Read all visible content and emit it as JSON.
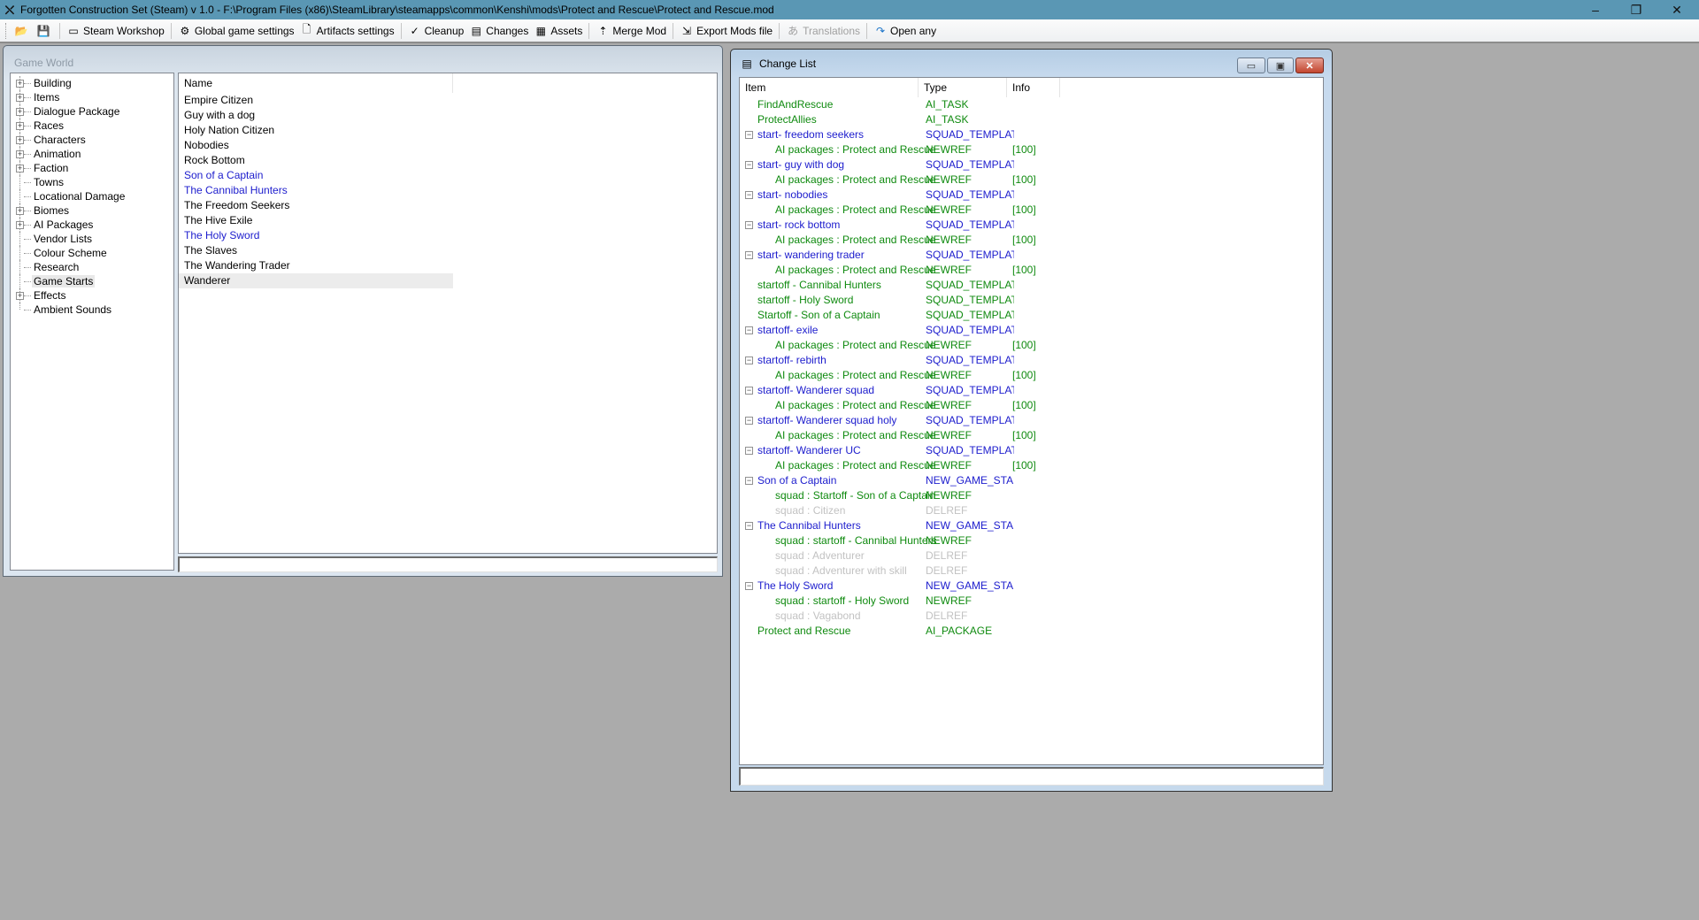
{
  "window": {
    "title": "Forgotten Construction Set (Steam) v 1.0 - F:\\Program Files (x86)\\SteamLibrary\\steamapps\\common\\Kenshi\\mods\\Protect and Rescue\\Protect and Rescue.mod",
    "controls": {
      "minimize": "–",
      "restore": "❐",
      "close": "✕"
    }
  },
  "toolbar": {
    "items": [
      {
        "label": "",
        "icon": "open-icon",
        "glyph": "📂"
      },
      {
        "label": "",
        "icon": "save-icon",
        "glyph": "💾"
      },
      {
        "label": "Steam Workshop",
        "icon": "workshop-icon",
        "glyph": "▭"
      },
      {
        "label": "Global game settings",
        "icon": "gear-icon",
        "glyph": "⚙"
      },
      {
        "label": "Artifacts settings",
        "icon": "document-gear-icon",
        "glyph": "🗋"
      },
      {
        "label": "Cleanup",
        "icon": "broom-icon",
        "glyph": "✓"
      },
      {
        "label": "Changes",
        "icon": "changes-icon",
        "glyph": "▤"
      },
      {
        "label": "Assets",
        "icon": "assets-icon",
        "glyph": "▦"
      },
      {
        "label": "Merge Mod",
        "icon": "merge-icon",
        "glyph": "⇡"
      },
      {
        "label": "Export Mods file",
        "icon": "export-icon",
        "glyph": "⇲"
      },
      {
        "label": "Translations",
        "icon": "translate-icon",
        "glyph": "あ",
        "disabled": true
      },
      {
        "label": "Open any",
        "icon": "redo-arrow-icon",
        "glyph": "↷"
      }
    ]
  },
  "game_world": {
    "title": "Game World",
    "tree": [
      {
        "label": "Building",
        "expandable": true
      },
      {
        "label": "Items",
        "expandable": true
      },
      {
        "label": "Dialogue Package",
        "expandable": true
      },
      {
        "label": "Races",
        "expandable": true
      },
      {
        "label": "Characters",
        "expandable": true
      },
      {
        "label": "Animation",
        "expandable": true
      },
      {
        "label": "Faction",
        "expandable": true
      },
      {
        "label": "Towns",
        "expandable": false
      },
      {
        "label": "Locational Damage",
        "expandable": false
      },
      {
        "label": "Biomes",
        "expandable": true
      },
      {
        "label": "AI Packages",
        "expandable": true
      },
      {
        "label": "Vendor Lists",
        "expandable": false
      },
      {
        "label": "Colour Scheme",
        "expandable": false
      },
      {
        "label": "Research",
        "expandable": false
      },
      {
        "label": "Game Starts",
        "expandable": false,
        "selected": true
      },
      {
        "label": "Effects",
        "expandable": true
      },
      {
        "label": "Ambient Sounds",
        "expandable": false
      }
    ],
    "list_header": "Name",
    "list": [
      {
        "name": "Empire Citizen",
        "color": "black"
      },
      {
        "name": "Guy with a dog",
        "color": "black"
      },
      {
        "name": "Holy Nation Citizen",
        "color": "black"
      },
      {
        "name": "Nobodies",
        "color": "black"
      },
      {
        "name": "Rock Bottom",
        "color": "black"
      },
      {
        "name": "Son of a Captain",
        "color": "blue"
      },
      {
        "name": "The Cannibal Hunters",
        "color": "blue"
      },
      {
        "name": "The Freedom Seekers",
        "color": "black"
      },
      {
        "name": "The Hive Exile",
        "color": "black"
      },
      {
        "name": "The Holy Sword",
        "color": "blue"
      },
      {
        "name": "The Slaves",
        "color": "black"
      },
      {
        "name": "The Wandering Trader",
        "color": "black"
      },
      {
        "name": "Wanderer",
        "color": "black",
        "selected": true
      }
    ],
    "filter_value": ""
  },
  "change_list": {
    "title": "Change List",
    "columns": [
      "Item",
      "Type",
      "Info"
    ],
    "rows": [
      {
        "item": "FindAndRescue",
        "type": "AI_TASK",
        "info": "",
        "color": "green",
        "level": 0,
        "toggle": false
      },
      {
        "item": "ProtectAllies",
        "type": "AI_TASK",
        "info": "",
        "color": "green",
        "level": 0,
        "toggle": false
      },
      {
        "item": "start- freedom seekers",
        "type": "SQUAD_TEMPLATE",
        "info": "",
        "color": "blue",
        "level": 0,
        "toggle": true
      },
      {
        "item": "AI packages : Protect and Rescue",
        "type": "NEWREF",
        "info": "[100]",
        "color": "green",
        "level": 1
      },
      {
        "item": "start- guy with dog",
        "type": "SQUAD_TEMPLATE",
        "info": "",
        "color": "blue",
        "level": 0,
        "toggle": true
      },
      {
        "item": "AI packages : Protect and Rescue",
        "type": "NEWREF",
        "info": "[100]",
        "color": "green",
        "level": 1
      },
      {
        "item": "start- nobodies",
        "type": "SQUAD_TEMPLATE",
        "info": "",
        "color": "blue",
        "level": 0,
        "toggle": true
      },
      {
        "item": "AI packages : Protect and Rescue",
        "type": "NEWREF",
        "info": "[100]",
        "color": "green",
        "level": 1
      },
      {
        "item": "start- rock bottom",
        "type": "SQUAD_TEMPLATE",
        "info": "",
        "color": "blue",
        "level": 0,
        "toggle": true
      },
      {
        "item": "AI packages : Protect and Rescue",
        "type": "NEWREF",
        "info": "[100]",
        "color": "green",
        "level": 1
      },
      {
        "item": "start- wandering trader",
        "type": "SQUAD_TEMPLATE",
        "info": "",
        "color": "blue",
        "level": 0,
        "toggle": true
      },
      {
        "item": "AI packages : Protect and Rescue",
        "type": "NEWREF",
        "info": "[100]",
        "color": "green",
        "level": 1
      },
      {
        "item": "startoff - Cannibal Hunters",
        "type": "SQUAD_TEMPLATE",
        "info": "",
        "color": "green",
        "level": 0,
        "toggle": false
      },
      {
        "item": "startoff - Holy Sword",
        "type": "SQUAD_TEMPLATE",
        "info": "",
        "color": "green",
        "level": 0,
        "toggle": false
      },
      {
        "item": "Startoff - Son of a Captain",
        "type": "SQUAD_TEMPLATE",
        "info": "",
        "color": "green",
        "level": 0,
        "toggle": false
      },
      {
        "item": "startoff- exile",
        "type": "SQUAD_TEMPLATE",
        "info": "",
        "color": "blue",
        "level": 0,
        "toggle": true
      },
      {
        "item": "AI packages : Protect and Rescue",
        "type": "NEWREF",
        "info": "[100]",
        "color": "green",
        "level": 1
      },
      {
        "item": "startoff- rebirth",
        "type": "SQUAD_TEMPLATE",
        "info": "",
        "color": "blue",
        "level": 0,
        "toggle": true
      },
      {
        "item": "AI packages : Protect and Rescue",
        "type": "NEWREF",
        "info": "[100]",
        "color": "green",
        "level": 1
      },
      {
        "item": "startoff- Wanderer squad",
        "type": "SQUAD_TEMPLATE",
        "info": "",
        "color": "blue",
        "level": 0,
        "toggle": true
      },
      {
        "item": "AI packages : Protect and Rescue",
        "type": "NEWREF",
        "info": "[100]",
        "color": "green",
        "level": 1
      },
      {
        "item": "startoff- Wanderer squad holy",
        "type": "SQUAD_TEMPLATE",
        "info": "",
        "color": "blue",
        "level": 0,
        "toggle": true
      },
      {
        "item": "AI packages : Protect and Rescue",
        "type": "NEWREF",
        "info": "[100]",
        "color": "green",
        "level": 1
      },
      {
        "item": "startoff- Wanderer UC",
        "type": "SQUAD_TEMPLATE",
        "info": "",
        "color": "blue",
        "level": 0,
        "toggle": true
      },
      {
        "item": "AI packages : Protect and Rescue",
        "type": "NEWREF",
        "info": "[100]",
        "color": "green",
        "level": 1
      },
      {
        "item": "Son of a Captain",
        "type": "NEW_GAME_START",
        "info": "",
        "color": "blue",
        "level": 0,
        "toggle": true
      },
      {
        "item": "squad : Startoff - Son of a Captain",
        "type": "NEWREF",
        "info": "",
        "color": "green",
        "level": 1
      },
      {
        "item": "squad : Citizen",
        "type": "DELREF",
        "info": "",
        "color": "gray",
        "level": 1
      },
      {
        "item": "The Cannibal Hunters",
        "type": "NEW_GAME_START",
        "info": "",
        "color": "blue",
        "level": 0,
        "toggle": true
      },
      {
        "item": "squad : startoff - Cannibal Hunters",
        "type": "NEWREF",
        "info": "",
        "color": "green",
        "level": 1
      },
      {
        "item": "squad : Adventurer",
        "type": "DELREF",
        "info": "",
        "color": "gray",
        "level": 1
      },
      {
        "item": "squad : Adventurer with skill",
        "type": "DELREF",
        "info": "",
        "color": "gray",
        "level": 1
      },
      {
        "item": "The Holy Sword",
        "type": "NEW_GAME_START",
        "info": "",
        "color": "blue",
        "level": 0,
        "toggle": true
      },
      {
        "item": "squad : startoff - Holy Sword",
        "type": "NEWREF",
        "info": "",
        "color": "green",
        "level": 1
      },
      {
        "item": "squad : Vagabond",
        "type": "DELREF",
        "info": "",
        "color": "gray",
        "level": 1
      },
      {
        "item": "Protect and Rescue",
        "type": "AI_PACKAGE",
        "info": "",
        "color": "green",
        "level": 0,
        "toggle": false
      }
    ],
    "filter_value": ""
  }
}
